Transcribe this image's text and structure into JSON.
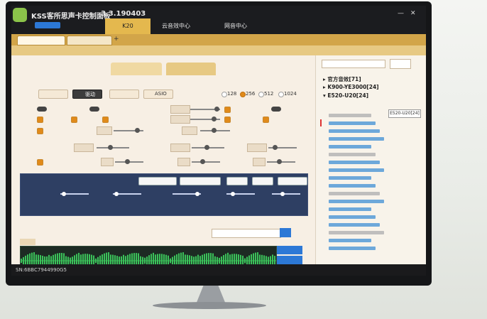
{
  "app": {
    "title": "KSS客所思声卡控制面板",
    "version": "3.3.190403"
  },
  "titlebar": {
    "min": "—",
    "close": "✕"
  },
  "left_mini": {},
  "device_tabs": [
    {
      "label": "K20",
      "active": true
    },
    {
      "label": "云音效中心",
      "active": false
    },
    {
      "label": "网音中心",
      "active": false
    }
  ],
  "doc_tabs": [],
  "panel_tabs": [],
  "drivers": {
    "label": "驱动",
    "options": [
      {
        "label": "ASIO",
        "selected": false
      }
    ]
  },
  "sample_rate": {
    "options": [
      {
        "label": "128",
        "selected": false
      },
      {
        "label": "256",
        "selected": true
      },
      {
        "label": "512",
        "selected": false
      },
      {
        "label": "1024",
        "selected": false
      }
    ]
  },
  "function": {},
  "wave": {
    "buttons": []
  },
  "status": {
    "text": "SN:6BBC7944990G5"
  },
  "right_panel": {
    "search_placeholder": "",
    "tree": [
      {
        "label": "官方音效[71]",
        "expanded": false
      },
      {
        "label": "K900-YE3000[24]",
        "expanded": false
      },
      {
        "label": "E520-U20[24]",
        "expanded": true
      }
    ],
    "tooltip": "E520-U20[24]"
  },
  "colors": {
    "accent": "#e4b84e",
    "blue": "#2c78d6",
    "dark": "#1b1c1f",
    "wave": "#3bc25a"
  }
}
